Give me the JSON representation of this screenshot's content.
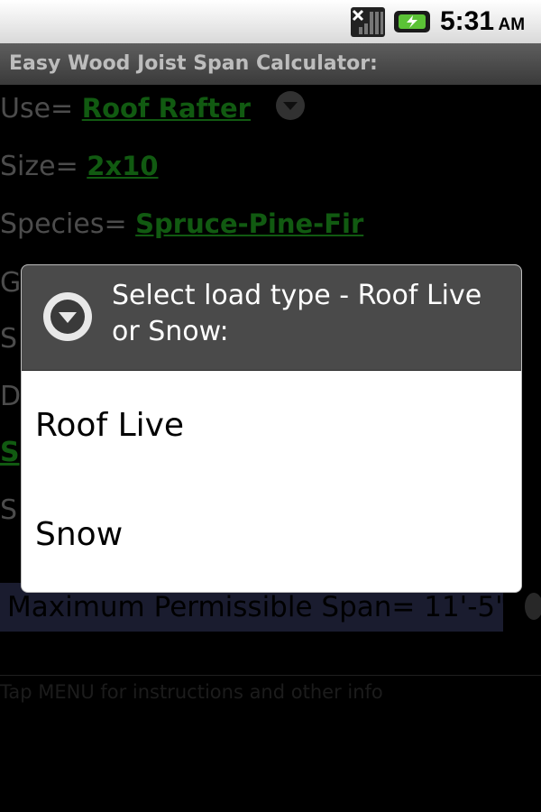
{
  "status_bar": {
    "time": "5:31",
    "ampm": "AM",
    "signal_icon": "signal-icon",
    "battery_icon": "battery-charging-icon"
  },
  "app": {
    "title": "Easy Wood Joist Span Calculator:"
  },
  "form": {
    "use_label": "Use=",
    "use_value": "Roof Rafter",
    "size_label": "Size=",
    "size_value": "2x10",
    "species_label": "Species=",
    "species_value": "Spruce-Pine-Fir",
    "partial_rows": [
      "G",
      "S",
      "D",
      "S",
      "S"
    ]
  },
  "result": {
    "text": "Maximum Permissible Span= 11'-5\""
  },
  "hint": "Tap MENU for instructions and other info",
  "dialog": {
    "title": "Select load type - Roof Live or Snow:",
    "icon": "dropdown-circle-icon",
    "options": [
      "Roof Live",
      "Snow"
    ]
  },
  "colors": {
    "accent_green": "#1fa51f",
    "dialog_header": "#4a4a4a",
    "result_bg": "#313457"
  }
}
